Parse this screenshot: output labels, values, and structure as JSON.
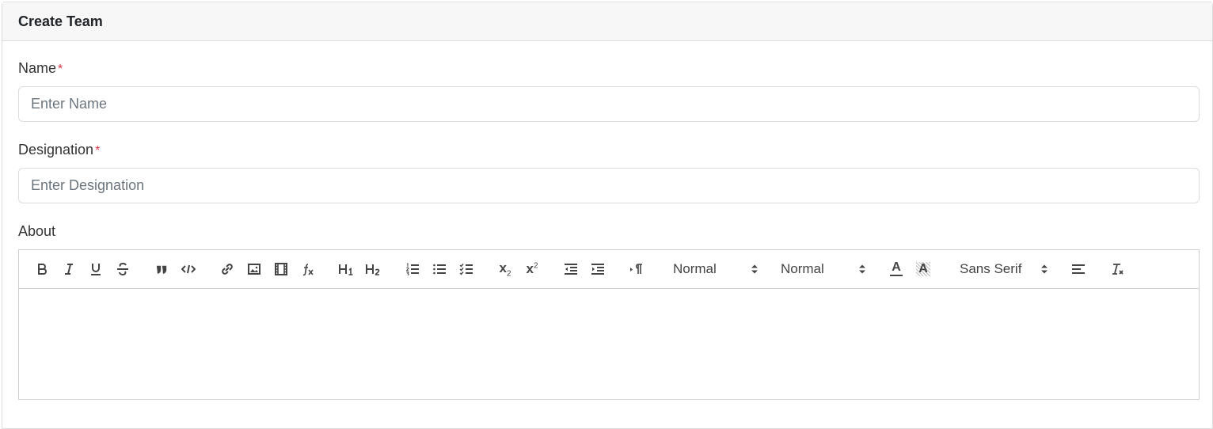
{
  "card": {
    "title": "Create Team"
  },
  "form": {
    "name": {
      "label": "Name",
      "required_mark": "*",
      "placeholder": "Enter Name"
    },
    "designation": {
      "label": "Designation",
      "required_mark": "*",
      "placeholder": "Enter Designation"
    },
    "about": {
      "label": "About"
    }
  },
  "toolbar": {
    "header_select": "Normal",
    "size_select": "Normal",
    "font_select": "Sans Serif",
    "h1": "H1",
    "h2": "H2",
    "subscript": "x",
    "subscript_mark": "2",
    "superscript": "x",
    "superscript_mark": "2",
    "text_color": "A",
    "background_color": "A",
    "formula": "fx"
  },
  "colors": {
    "required": "#dc3545",
    "border": "#dcdcdc",
    "header_bg": "#f7f7f7",
    "icon": "#444444"
  }
}
